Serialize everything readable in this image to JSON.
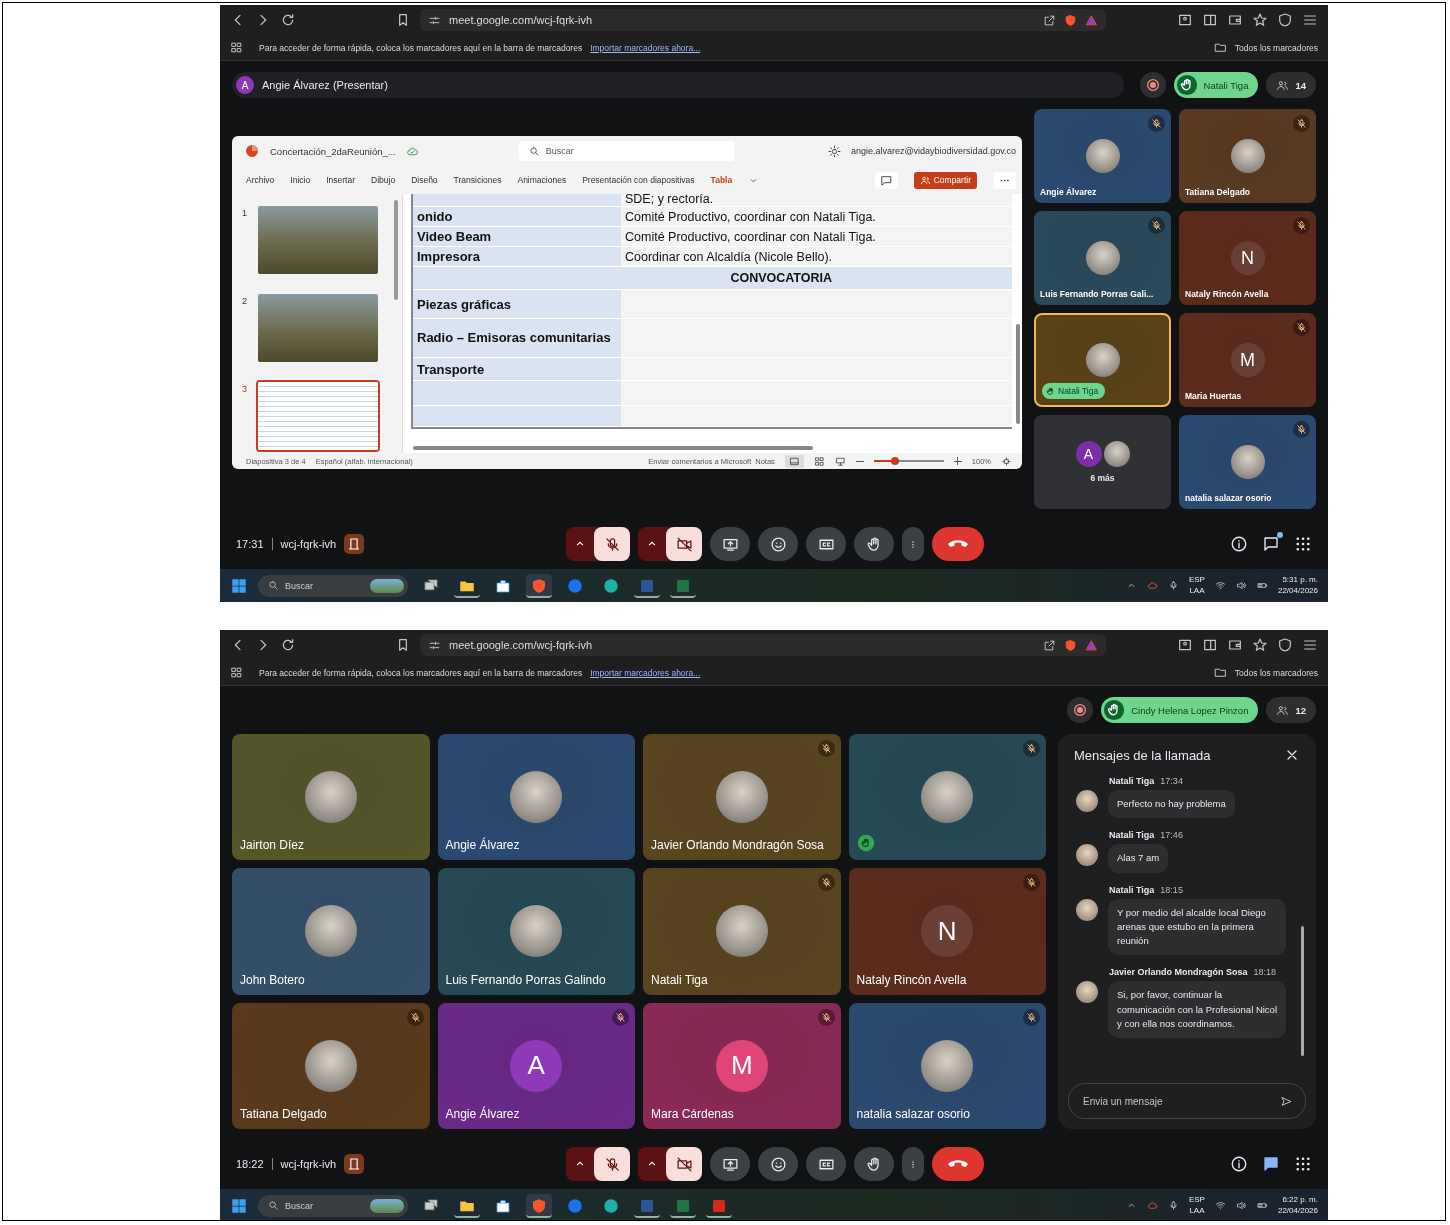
{
  "screens": [
    {
      "kind": "presentation",
      "browser": {
        "url": "meet.google.com/wcj-fqrk-ivh",
        "bookmarks_hint": "Para acceder de forma rápida, coloca los marcadores aquí en la barra de marcadores",
        "bookmarks_import": "Importar marcadores ahora...",
        "all_bookmarks": "Todos los marcadores"
      },
      "presenter": {
        "initial": "A",
        "label": "Angie Álvarez (Presentar)"
      },
      "top_bar": {
        "hand_raised_by": "Natali Tiga",
        "participants": "14"
      },
      "presentation": {
        "file_name": "Concertación_2daReunión_...",
        "search_placeholder": "Buscar",
        "account": "angie.alvarez@vidaybiodiversidad.gov.co",
        "share": "Compartir",
        "ribbon_tabs": [
          {
            "label": "Archivo",
            "selected": false
          },
          {
            "label": "Inicio",
            "selected": false
          },
          {
            "label": "Insertar",
            "selected": false
          },
          {
            "label": "Dibujo",
            "selected": false
          },
          {
            "label": "Diseño",
            "selected": false
          },
          {
            "label": "Transiciones",
            "selected": false
          },
          {
            "label": "Animaciones",
            "selected": false
          },
          {
            "label": "Presentación con diapositivas",
            "selected": false
          },
          {
            "label": "Tabla",
            "selected": true
          }
        ],
        "slides": [
          {
            "number": "1",
            "selected": false
          },
          {
            "number": "2",
            "selected": false
          },
          {
            "number": "3",
            "selected": true
          }
        ],
        "table_rows": [
          {
            "kind": "row",
            "cells": [
              "",
              "SDE; y rectoría."
            ]
          },
          {
            "kind": "row",
            "cells": [
              "onido",
              "Comité Productivo, coordinar con Natali Tiga."
            ]
          },
          {
            "kind": "row",
            "cells": [
              "Video Beam",
              "Comité Productivo, coordinar con Natali Tiga."
            ]
          },
          {
            "kind": "row",
            "cells": [
              "Impresora",
              "Coordinar con Alcaldía (Nicole Bello)."
            ]
          },
          {
            "kind": "section",
            "cells": [
              "CONVOCATORIA"
            ]
          },
          {
            "kind": "row",
            "cells": [
              "Piezas gráficas",
              ""
            ]
          },
          {
            "kind": "row",
            "cells": [
              "Radio – Emisoras comunitarias",
              ""
            ]
          },
          {
            "kind": "row",
            "cells": [
              "Transporte",
              ""
            ]
          },
          {
            "kind": "row",
            "cells": [
              "",
              ""
            ]
          },
          {
            "kind": "row",
            "cells": [
              "",
              ""
            ]
          }
        ],
        "status": {
          "slide": "Diapositiva 3 de 4",
          "language": "Español (alfab. internacional)",
          "feedback": "Enviar comentarios a Microsoft",
          "notes": "Notas",
          "zoom": "100%"
        },
        "zoom_slider": {
          "level": 0.3
        }
      },
      "tiles": [
        {
          "kind": "participant",
          "name": "Angie Álvarez",
          "color": "#2c4a70",
          "avatar": {
            "kind": "photo"
          },
          "muted": true,
          "hand_raised": false,
          "speaking": false
        },
        {
          "kind": "participant",
          "name": "Tatiana Delgado",
          "color": "#5a3a22",
          "avatar": {
            "kind": "photo"
          },
          "muted": true,
          "hand_raised": false,
          "speaking": false
        },
        {
          "kind": "participant",
          "name": "Luis Fernando Porras Gali...",
          "color": "#2a4a5c",
          "avatar": {
            "kind": "photo"
          },
          "muted": true,
          "hand_raised": false,
          "speaking": false
        },
        {
          "kind": "participant",
          "name": "Nataly Rincón Avella",
          "color": "#5c2c1c",
          "avatar": {
            "kind": "initial",
            "initial": "N",
            "color": "#6a4034"
          },
          "muted": true,
          "hand_raised": false,
          "speaking": false
        },
        {
          "kind": "participant",
          "name": "Natali Tiga",
          "color": "#5a4318",
          "avatar": {
            "kind": "photo"
          },
          "muted": false,
          "hand_raised": true,
          "speaking": true
        },
        {
          "kind": "participant",
          "name": "Maria Huertas",
          "color": "#5c2c1c",
          "avatar": {
            "kind": "initial",
            "initial": "M",
            "color": "#6a4034"
          },
          "muted": true,
          "hand_raised": false,
          "speaking": false
        },
        {
          "kind": "overflow",
          "label": "6 más",
          "color": "#303134",
          "avatars": [
            {
              "kind": "initial",
              "initial": "A",
              "color": "#7b2fa8"
            },
            {
              "kind": "photo"
            }
          ]
        },
        {
          "kind": "participant",
          "name": "natalia salazar osorio",
          "color": "#2c4a70",
          "avatar": {
            "kind": "photo"
          },
          "muted": true,
          "hand_raised": false,
          "speaking": false
        }
      ],
      "bottom_bar": {
        "time": "17:31",
        "code": "wcj-fqrk-ivh",
        "mic_on": false,
        "camera_on": false,
        "chat_open": false,
        "chat_unread": true
      },
      "taskbar": {
        "search": "Buscar",
        "apps": [
          {
            "kind": "taskview",
            "open": false
          },
          {
            "kind": "files",
            "open": true
          },
          {
            "kind": "store",
            "open": false
          },
          {
            "kind": "brave",
            "open": true
          },
          {
            "kind": "blue",
            "open": false
          },
          {
            "kind": "edge",
            "open": false
          },
          {
            "kind": "word",
            "open": true
          },
          {
            "kind": "excel",
            "open": true
          }
        ],
        "language": "ESP",
        "region": "LAA",
        "time": "5:31 p. m.",
        "date": "22/04/2026"
      }
    },
    {
      "kind": "grid",
      "browser": {
        "url": "meet.google.com/wcj-fqrk-ivh",
        "bookmarks_hint": "Para acceder de forma rápida, coloca los marcadores aquí en la barra de marcadores",
        "bookmarks_import": "Importar marcadores ahora...",
        "all_bookmarks": "Todos los marcadores"
      },
      "top_bar": {
        "hand_raised_by": "Cindy Helena Lopez Pinzon",
        "participants": "12"
      },
      "tiles": [
        {
          "kind": "participant",
          "name": "Jairton Díez",
          "color": "#55562a",
          "avatar": {
            "kind": "photo"
          },
          "muted": false,
          "hand_raised": false,
          "speaking": false
        },
        {
          "kind": "participant",
          "name": "Angie Álvarez",
          "color": "#2c4a70",
          "avatar": {
            "kind": "photo"
          },
          "muted": false,
          "hand_raised": false,
          "speaking": false
        },
        {
          "kind": "participant",
          "name": "Javier Orlando Mondragón Sosa",
          "color": "#5a4520",
          "avatar": {
            "kind": "photo"
          },
          "muted": true,
          "hand_raised": false,
          "speaking": false
        },
        {
          "kind": "participant",
          "color": "#264a56",
          "avatar": {
            "kind": "photo"
          },
          "muted": true,
          "hand_raised": true,
          "speaking": false
        },
        {
          "kind": "participant",
          "name": "John Botero",
          "color": "#34506a",
          "avatar": {
            "kind": "photo"
          },
          "muted": false,
          "hand_raised": false,
          "speaking": false
        },
        {
          "kind": "participant",
          "name": "Luis Fernando Porras Galindo",
          "color": "#264a56",
          "avatar": {
            "kind": "photo"
          },
          "muted": false,
          "hand_raised": false,
          "speaking": false
        },
        {
          "kind": "participant",
          "name": "Natali Tiga",
          "color": "#5a4520",
          "avatar": {
            "kind": "photo"
          },
          "muted": true,
          "hand_raised": false,
          "speaking": false
        },
        {
          "kind": "participant",
          "name": "Nataly Rincón Avella",
          "color": "#5c2c1c",
          "avatar": {
            "kind": "initial",
            "initial": "N",
            "color": "#6a4034"
          },
          "muted": true,
          "hand_raised": false,
          "speaking": false
        },
        {
          "kind": "participant",
          "name": "Tatiana Delgado",
          "color": "#5a3a1c",
          "avatar": {
            "kind": "photo"
          },
          "muted": true,
          "hand_raised": false,
          "speaking": false
        },
        {
          "kind": "participant",
          "name": "Angie Álvarez",
          "color": "#6a2a8a",
          "avatar": {
            "kind": "initial",
            "initial": "A",
            "color": "#8e3ab8"
          },
          "muted": true,
          "hand_raised": false,
          "speaking": false
        },
        {
          "kind": "participant",
          "name": "Mara Cárdenas",
          "color": "#8a2a56",
          "avatar": {
            "kind": "initial",
            "initial": "M",
            "color": "#e0457a"
          },
          "muted": true,
          "hand_raised": false,
          "speaking": false
        },
        {
          "kind": "participant",
          "name": "natalia salazar osorio",
          "color": "#2c4a70",
          "avatar": {
            "kind": "photo"
          },
          "muted": true,
          "hand_raised": false,
          "speaking": false
        }
      ],
      "chat": {
        "title": "Mensajes de la llamada",
        "placeholder": "Envia un mensaje",
        "messages": [
          {
            "sender": "Natali Tiga",
            "time": "17:34",
            "text": "Perfecto no hay problema"
          },
          {
            "sender": "Natali Tiga",
            "time": "17:46",
            "text": "Alas 7 am"
          },
          {
            "sender": "Natali Tiga",
            "time": "18:15",
            "text": "Y por medio del alcalde local Diego arenas  que estubo en la primera reunión"
          },
          {
            "sender": "Javier Orlando Mondragón Sosa",
            "time": "18:18",
            "text": "Si, por favor, continuar la comunicación con la Profesional Nicol y con ella nos coordinamos."
          }
        ]
      },
      "bottom_bar": {
        "time": "18:22",
        "code": "wcj-fqrk-ivh",
        "mic_on": false,
        "camera_on": false,
        "chat_open": true,
        "chat_unread": false
      },
      "taskbar": {
        "search": "Buscar",
        "apps": [
          {
            "kind": "taskview",
            "open": false
          },
          {
            "kind": "files",
            "open": true
          },
          {
            "kind": "store",
            "open": false
          },
          {
            "kind": "brave",
            "open": true
          },
          {
            "kind": "blue",
            "open": false
          },
          {
            "kind": "edge",
            "open": false
          },
          {
            "kind": "word",
            "open": true
          },
          {
            "kind": "excel",
            "open": true
          },
          {
            "kind": "pdf",
            "open": true
          }
        ],
        "language": "ESP",
        "region": "LAA",
        "time": "6:22 p. m.",
        "date": "22/04/2026"
      }
    }
  ]
}
